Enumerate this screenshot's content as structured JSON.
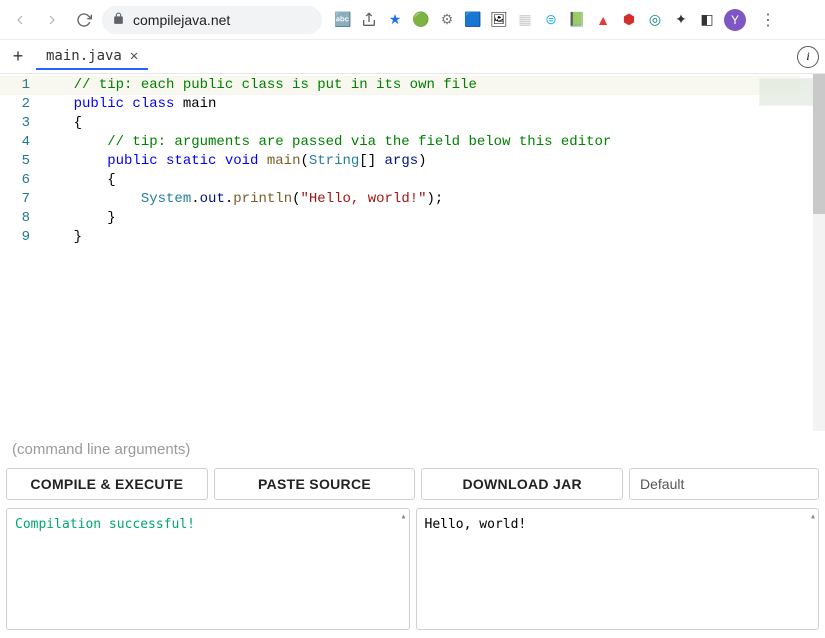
{
  "browser": {
    "url": "compilejava.net",
    "avatar_letter": "Y"
  },
  "tab": {
    "filename": "main.java"
  },
  "editor": {
    "lines": [
      {
        "n": "1",
        "segs": [
          [
            "    ",
            ""
          ],
          [
            "// tip: each public class is put in its own file",
            "c-comm"
          ]
        ]
      },
      {
        "n": "2",
        "segs": [
          [
            "    ",
            ""
          ],
          [
            "public class ",
            "c-kw"
          ],
          [
            "main",
            ""
          ]
        ]
      },
      {
        "n": "3",
        "segs": [
          [
            "    {",
            ""
          ]
        ]
      },
      {
        "n": "4",
        "segs": [
          [
            "        ",
            ""
          ],
          [
            "// tip: arguments are passed via the field below this editor",
            "c-comm"
          ]
        ]
      },
      {
        "n": "5",
        "segs": [
          [
            "        ",
            ""
          ],
          [
            "public static ",
            "c-kw"
          ],
          [
            "void ",
            "c-kw"
          ],
          [
            "main",
            "c-fn"
          ],
          [
            "(",
            ""
          ],
          [
            "String",
            "c-type"
          ],
          [
            "[] ",
            ""
          ],
          [
            "args",
            "c-var"
          ],
          [
            ")",
            ""
          ]
        ]
      },
      {
        "n": "6",
        "segs": [
          [
            "        {",
            ""
          ]
        ]
      },
      {
        "n": "7",
        "segs": [
          [
            "            ",
            ""
          ],
          [
            "System",
            "c-type"
          ],
          [
            ".",
            ""
          ],
          [
            "out",
            "c-var"
          ],
          [
            ".",
            ""
          ],
          [
            "println",
            "c-fn"
          ],
          [
            "(",
            ""
          ],
          [
            "\"Hello, world!\"",
            "c-str"
          ],
          [
            ");",
            ""
          ]
        ]
      },
      {
        "n": "8",
        "segs": [
          [
            "        }",
            ""
          ]
        ]
      },
      {
        "n": "9",
        "segs": [
          [
            "    }",
            ""
          ]
        ]
      }
    ]
  },
  "cmdline_placeholder": "(command line arguments)",
  "buttons": {
    "compile": "COMPILE & EXECUTE",
    "paste": "PASTE SOURCE",
    "download": "DOWNLOAD JAR",
    "theme": "Default"
  },
  "output": {
    "compile_msg": "Compilation successful!",
    "run_msg": "Hello, world!"
  }
}
